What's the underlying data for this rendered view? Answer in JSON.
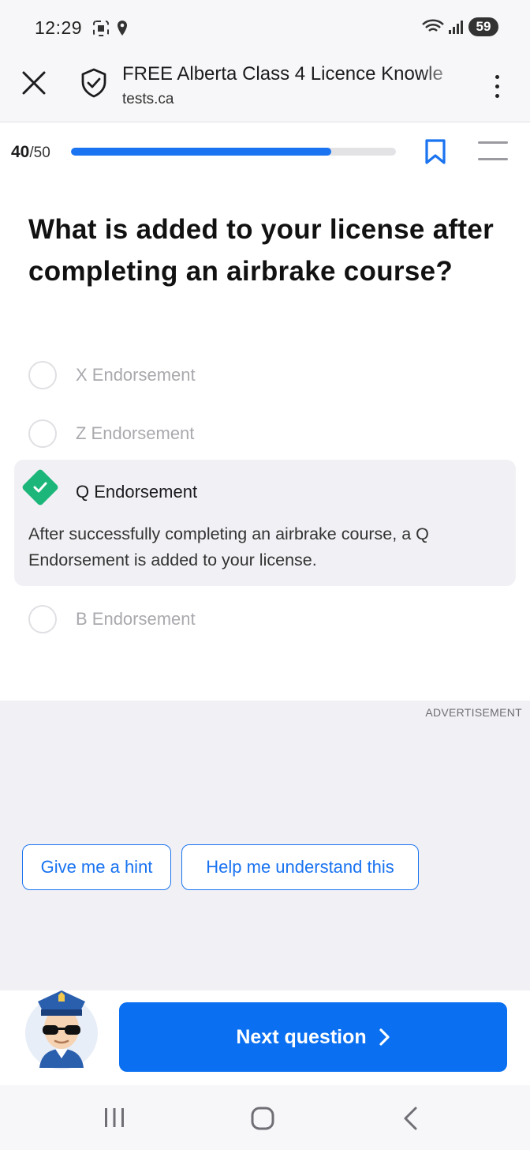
{
  "status_bar": {
    "time": "12:29",
    "battery": "59"
  },
  "browser": {
    "title": "FREE Alberta Class 4 Licence Knowle",
    "url": "tests.ca"
  },
  "progress": {
    "current": "40",
    "total": "/50",
    "fraction": 0.8
  },
  "question": {
    "text": "What is added to your license after completing an airbrake course?"
  },
  "options": [
    {
      "label": "X Endorsement"
    },
    {
      "label": "Z Endorsement"
    },
    {
      "label": "Q Endorsement",
      "correct": true
    },
    {
      "label": "B Endorsement"
    }
  ],
  "explanation": "After successfully completing an airbrake course, a Q Endorsement is added to your license.",
  "ad": {
    "label": "ADVERTISEMENT"
  },
  "helpers": {
    "hint_label": "Give me a hint",
    "understand_label": "Help me understand this"
  },
  "next_button": {
    "label": "Next question"
  },
  "colors": {
    "accent": "#0a6ff0",
    "correct": "#1db67a"
  }
}
